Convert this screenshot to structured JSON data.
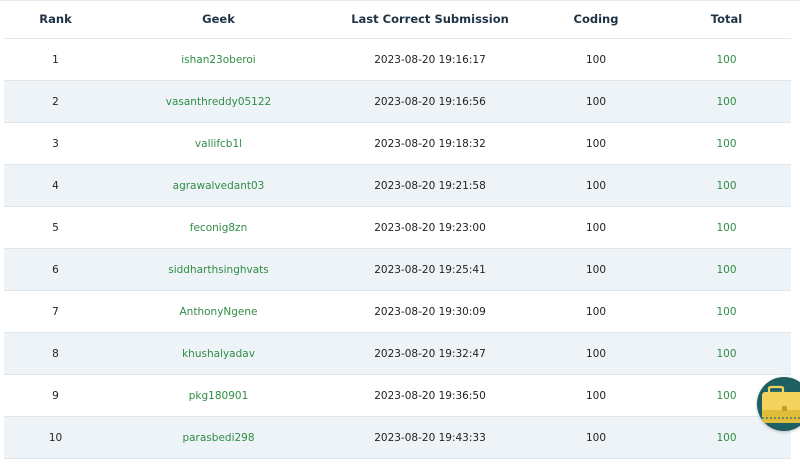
{
  "table": {
    "headers": {
      "rank": "Rank",
      "geek": "Geek",
      "last_submission": "Last Correct Submission",
      "coding": "Coding",
      "total": "Total"
    },
    "rows": [
      {
        "rank": "1",
        "geek": "ishan23oberoi",
        "last_submission": "2023-08-20 19:16:17",
        "coding": "100",
        "total": "100"
      },
      {
        "rank": "2",
        "geek": "vasanthreddy05122",
        "last_submission": "2023-08-20 19:16:56",
        "coding": "100",
        "total": "100"
      },
      {
        "rank": "3",
        "geek": "vallifcb1l",
        "last_submission": "2023-08-20 19:18:32",
        "coding": "100",
        "total": "100"
      },
      {
        "rank": "4",
        "geek": "agrawalvedant03",
        "last_submission": "2023-08-20 19:21:58",
        "coding": "100",
        "total": "100"
      },
      {
        "rank": "5",
        "geek": "feconig8zn",
        "last_submission": "2023-08-20 19:23:00",
        "coding": "100",
        "total": "100"
      },
      {
        "rank": "6",
        "geek": "siddharthsinghvats",
        "last_submission": "2023-08-20 19:25:41",
        "coding": "100",
        "total": "100"
      },
      {
        "rank": "7",
        "geek": "AnthonyNgene",
        "last_submission": "2023-08-20 19:30:09",
        "coding": "100",
        "total": "100"
      },
      {
        "rank": "8",
        "geek": "khushalyadav",
        "last_submission": "2023-08-20 19:32:47",
        "coding": "100",
        "total": "100"
      },
      {
        "rank": "9",
        "geek": "pkg180901",
        "last_submission": "2023-08-20 19:36:50",
        "coding": "100",
        "total": "100"
      },
      {
        "rank": "10",
        "geek": "parasbedi298",
        "last_submission": "2023-08-20 19:43:33",
        "coding": "100",
        "total": "100"
      }
    ]
  },
  "widget": {
    "icon": "briefcase-icon"
  },
  "colors": {
    "accent_green": "#2f8d46",
    "header_text": "#1f3347",
    "alt_row": "#edf3f6",
    "widget_bg": "#1e5f63",
    "briefcase": "#f2d35c"
  }
}
